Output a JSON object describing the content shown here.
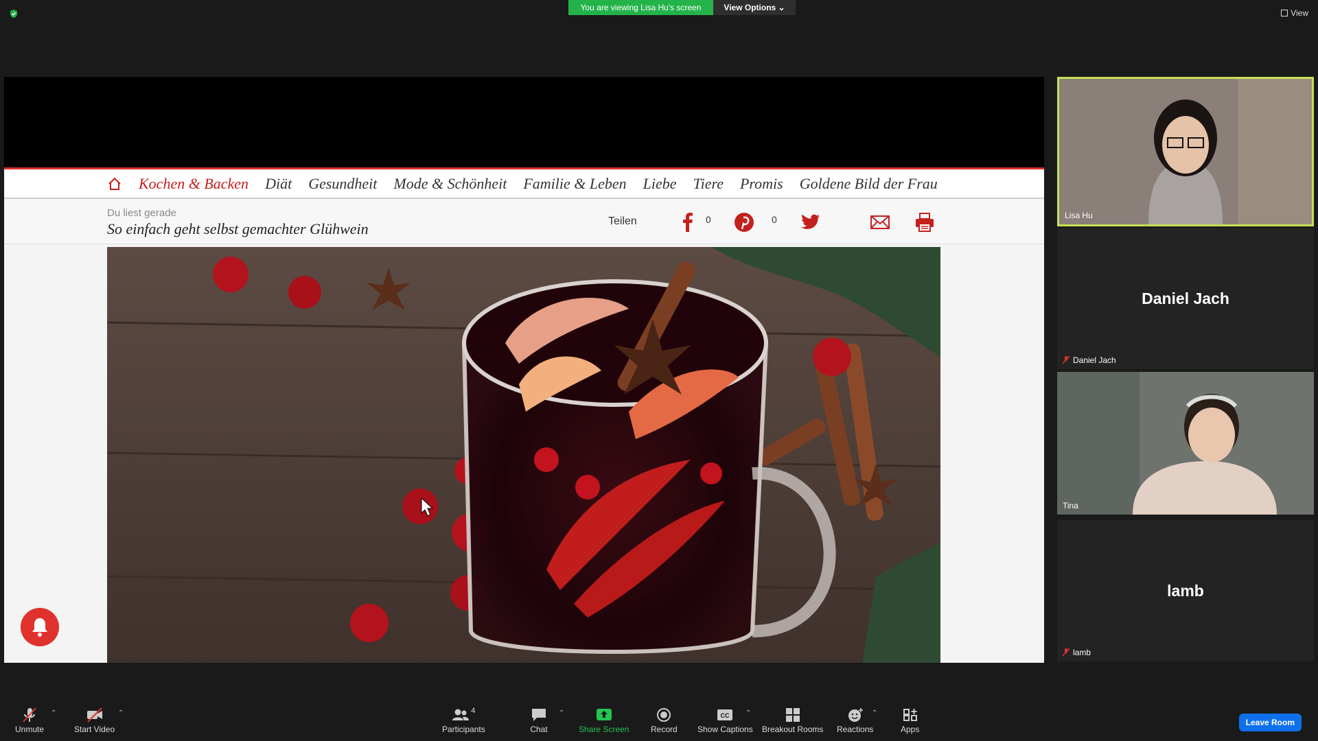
{
  "banner": {
    "viewing": "You are viewing Lisa Hu's screen",
    "view_options": "View Options"
  },
  "top_right": {
    "view": "View"
  },
  "site": {
    "nav": [
      "Kochen & Backen",
      "Diät",
      "Gesundheit",
      "Mode & Schönheit",
      "Familie & Leben",
      "Liebe",
      "Tiere",
      "Promis",
      "Goldene Bild der Frau"
    ],
    "reading_label": "Du liest gerade",
    "reading_title": "So einfach geht selbst gemachter Glühwein",
    "share_label": "Teilen",
    "facebook_count": "0",
    "pinterest_count": "0"
  },
  "participants": [
    {
      "name": "Lisa Hu",
      "video": true,
      "muted": false
    },
    {
      "name": "Daniel Jach",
      "video": false,
      "muted": true
    },
    {
      "name": "Tina",
      "video": true,
      "muted": false
    },
    {
      "name": "lamb",
      "video": false,
      "muted": true
    }
  ],
  "toolbar": {
    "unmute": "Unmute",
    "start_video": "Start Video",
    "participants": "Participants",
    "participants_count": "4",
    "chat": "Chat",
    "share_screen": "Share Screen",
    "record": "Record",
    "show_captions": "Show Captions",
    "breakout_rooms": "Breakout Rooms",
    "reactions": "Reactions",
    "apps": "Apps",
    "leave_room": "Leave Room"
  },
  "colors": {
    "active_share": "#23b34a",
    "site_accent": "#c4201e",
    "leave": "#0e71eb",
    "speaker_border": "#c7e053"
  }
}
